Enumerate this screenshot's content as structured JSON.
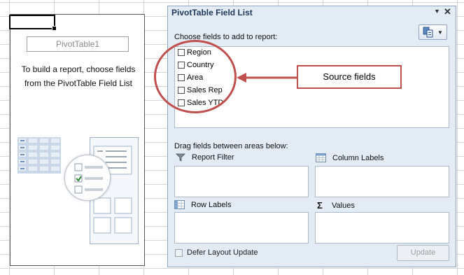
{
  "pivot": {
    "name_box": "PivotTable1",
    "help_text": "To build a report, choose fields from the PivotTable Field List"
  },
  "field_list": {
    "title": "PivotTable Field List",
    "dropdown_icon": "dropdown-arrow-icon",
    "close_icon": "close-icon",
    "choose_label": "Choose fields to add to report:",
    "layout_icon": "field-layout-icon",
    "fields": [
      {
        "label": "Region",
        "checked": false
      },
      {
        "label": "Country",
        "checked": false
      },
      {
        "label": "Area",
        "checked": false
      },
      {
        "label": "Sales Rep",
        "checked": false
      },
      {
        "label": "Sales YTD",
        "checked": false
      }
    ],
    "drag_label": "Drag fields between areas below:",
    "areas": {
      "report_filter": {
        "label": "Report Filter",
        "icon": "filter-icon"
      },
      "column_labels": {
        "label": "Column Labels",
        "icon": "columns-grid-icon"
      },
      "row_labels": {
        "label": "Row Labels",
        "icon": "rows-grid-icon"
      },
      "values": {
        "label": "Values",
        "icon": "sigma-icon"
      }
    },
    "defer_label": "Defer Layout Update",
    "update_button": "Update"
  },
  "annotation": {
    "callout_text": "Source fields",
    "color": "#c0504d"
  }
}
